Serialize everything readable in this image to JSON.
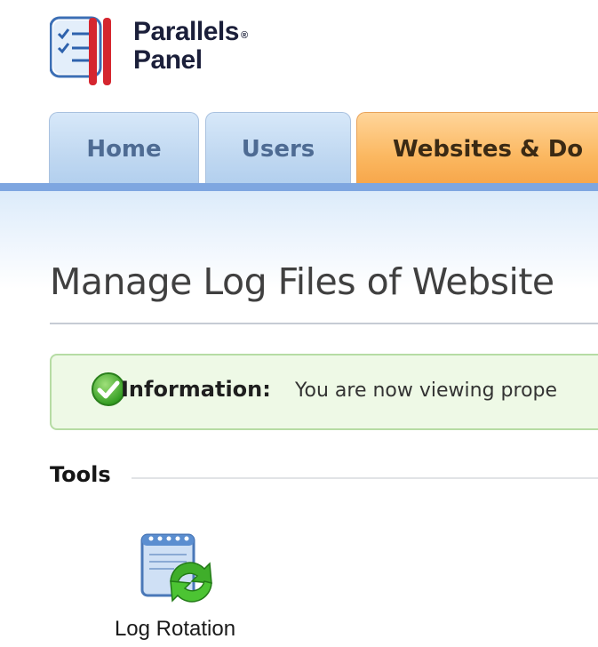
{
  "logo": {
    "line1": "Parallels",
    "line2": "Panel",
    "mark": "®"
  },
  "tabs": [
    {
      "label": "Home"
    },
    {
      "label": "Users"
    },
    {
      "label": "Websites & Do"
    }
  ],
  "page": {
    "title": "Manage Log Files of Website"
  },
  "info": {
    "icon": "check-circle-icon",
    "label": "Information:",
    "text": "You are now viewing prope"
  },
  "tools": {
    "heading": "Tools",
    "items": [
      {
        "label": "Log Rotation",
        "icon": "log-rotation-icon"
      }
    ]
  },
  "colors": {
    "accent_bar": "#7ea6e0",
    "active_tab": "#f7a64a",
    "info_bg": "#eef9e6"
  }
}
